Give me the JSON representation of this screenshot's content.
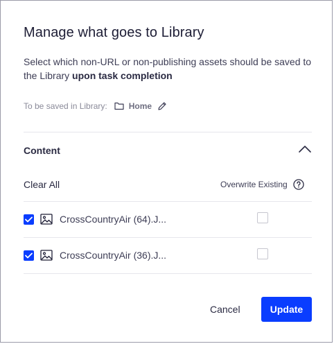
{
  "dialog": {
    "title": "Manage what goes to Library",
    "description_prefix": "Select which non-URL or non-publishing assets should be saved to the Library ",
    "description_bold": "upon task completion",
    "destination_label": "To be saved in Library:",
    "destination_folder": "Home"
  },
  "content": {
    "section_title": "Content",
    "clear_all_label": "Clear All",
    "overwrite_label": "Overwrite Existing",
    "items": [
      {
        "name": "CrossCountryAir (64).J...",
        "selected": true,
        "overwrite": false
      },
      {
        "name": "CrossCountryAir (36).J...",
        "selected": true,
        "overwrite": false
      }
    ]
  },
  "footer": {
    "cancel_label": "Cancel",
    "update_label": "Update"
  },
  "colors": {
    "accent": "#0a3dff",
    "text": "#1d1d35",
    "muted": "#8a8a99",
    "divider": "#e6e6ec"
  },
  "icons": [
    "folder-icon",
    "edit-icon",
    "chevron-up-icon",
    "help-icon",
    "image-icon",
    "check-icon"
  ]
}
